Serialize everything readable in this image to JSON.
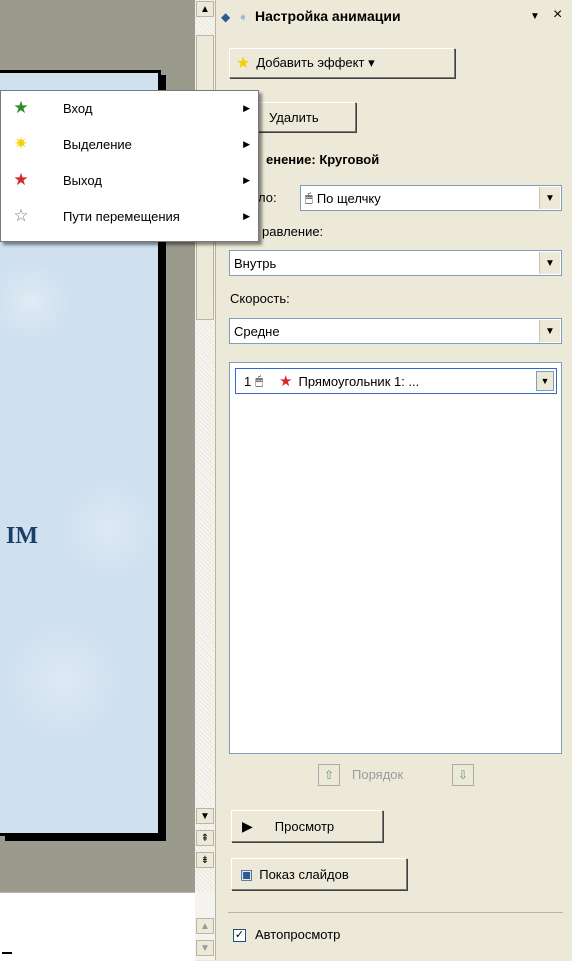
{
  "slide": {
    "text_fragment": "IM"
  },
  "pane": {
    "title": "Настройка анимации",
    "add_effect_label": "Добавить эффект ▾",
    "delete_label": "Удалить",
    "effect_heading": "енение: Круговой",
    "start_label": "ло:",
    "start_value": "По щелчку",
    "direction_label": "равление:",
    "direction_value": "Внутрь",
    "speed_label": "Скорость:",
    "speed_value": "Средне",
    "anim_item_index": "1",
    "anim_item_name": "Прямоугольник 1: ...",
    "order_label": "Порядок",
    "preview_label": "Просмотр",
    "slideshow_label": "Показ слайдов",
    "autopreview_label": "Автопросмотр",
    "autopreview_checked": true
  },
  "menu": {
    "items": [
      {
        "label": "Вход",
        "icon": "entrance-star-icon",
        "color": "#2e8b2e"
      },
      {
        "label": "Выделение",
        "icon": "emphasis-star-icon",
        "color": "#f2d100"
      },
      {
        "label": "Выход",
        "icon": "exit-star-icon",
        "color": "#d42a2a"
      },
      {
        "label": "Пути перемещения",
        "icon": "motion-path-star-icon",
        "color": "#ffffff"
      }
    ]
  }
}
